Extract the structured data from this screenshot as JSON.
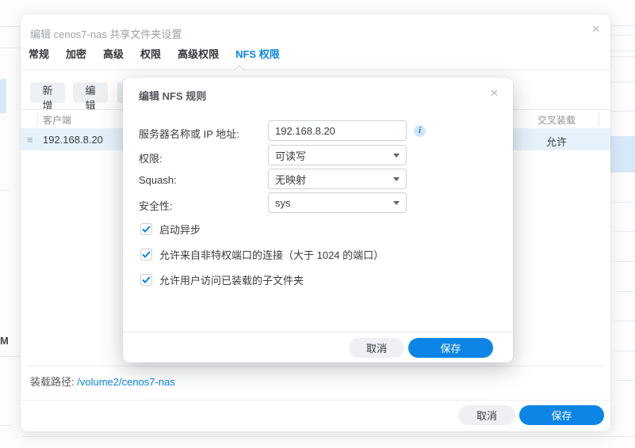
{
  "icons": {
    "close": "✕",
    "drag": "≡",
    "info": "i"
  },
  "background": {
    "partial_text": "M"
  },
  "dialog": {
    "title": "编辑 cenos7-nas 共享文件夹设置",
    "tabs": [
      {
        "label": "常规",
        "active": false
      },
      {
        "label": "加密",
        "active": false
      },
      {
        "label": "高级",
        "active": false
      },
      {
        "label": "权限",
        "active": false
      },
      {
        "label": "高级权限",
        "active": false
      },
      {
        "label": "NFS 权限",
        "active": true
      }
    ],
    "toolbar": {
      "add": "新增",
      "edit": "编辑"
    },
    "table": {
      "col_client": "客户端",
      "col_crossmount": "交叉装载",
      "row": {
        "client": "192.168.8.20",
        "crossmount": "允许"
      }
    },
    "mount_path_label": "装载路径:",
    "mount_path_value": "/volume2/cenos7-nas",
    "cancel": "取消",
    "save": "保存"
  },
  "modal": {
    "title": "编辑 NFS 规则",
    "server_label": "服务器名称或 IP 地址:",
    "server_value": "192.168.8.20",
    "privilege_label": "权限:",
    "privilege_value": "可读写",
    "squash_label": "Squash:",
    "squash_value": "无映射",
    "security_label": "安全性:",
    "security_value": "sys",
    "checkboxes": [
      {
        "label": "启动异步",
        "checked": true
      },
      {
        "label": "允许来自非特权端口的连接（大于 1024 的端口）",
        "checked": true
      },
      {
        "label": "允许用户访问已装载的子文件夹",
        "checked": true
      }
    ],
    "cancel": "取消",
    "save": "保存"
  },
  "colors": {
    "accent_blue": "#0c85e6",
    "selected_row": "#e6f2fb",
    "link_blue": "#0a85e6"
  }
}
